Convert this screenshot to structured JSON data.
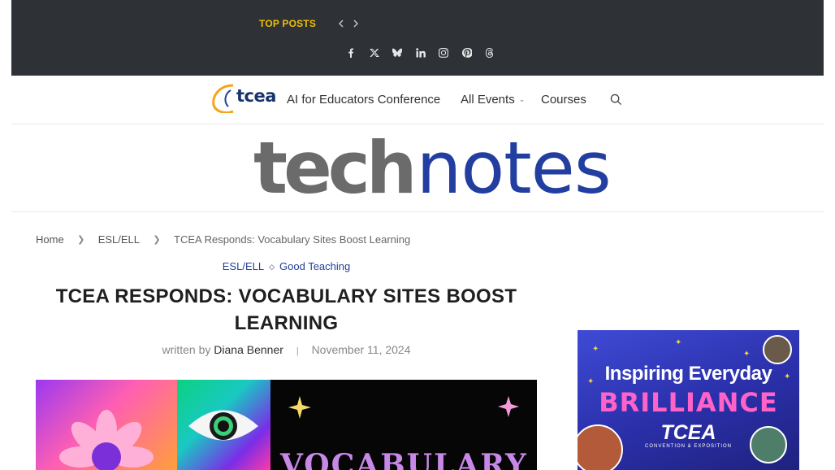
{
  "topbar": {
    "top_posts_label": "TOP POSTS",
    "accent_color": "#f0c000",
    "background_color": "#2e3136",
    "socials": [
      "facebook-icon",
      "x-icon",
      "bluesky-icon",
      "linkedin-icon",
      "instagram-icon",
      "pinterest-icon",
      "threads-icon"
    ]
  },
  "nav": {
    "logo_text": "tcea",
    "items": [
      {
        "label": "AI for Educators Conference"
      },
      {
        "label": "All Events",
        "has_dropdown": true
      },
      {
        "label": "Courses"
      }
    ]
  },
  "masthead": {
    "logo_part1": "tech",
    "logo_part2": "notes"
  },
  "breadcrumb": {
    "home": "Home",
    "category": "ESL/ELL",
    "current": "TCEA Responds: Vocabulary Sites Boost Learning"
  },
  "article": {
    "categories": [
      "ESL/ELL",
      "Good Teaching"
    ],
    "title": "TCEA RESPONDS: VOCABULARY SITES BOOST LEARNING",
    "written_by_label": "written by",
    "author": "Diana Benner",
    "date": "November 11, 2024",
    "link_color": "#233f9a"
  },
  "hero": {
    "word": "VOCABULARY"
  },
  "ad": {
    "line1": "Inspiring Everyday",
    "line2": "BRILLIANCE",
    "brand": "TCEA",
    "sub": "CONVENTION & EXPOSITION"
  }
}
